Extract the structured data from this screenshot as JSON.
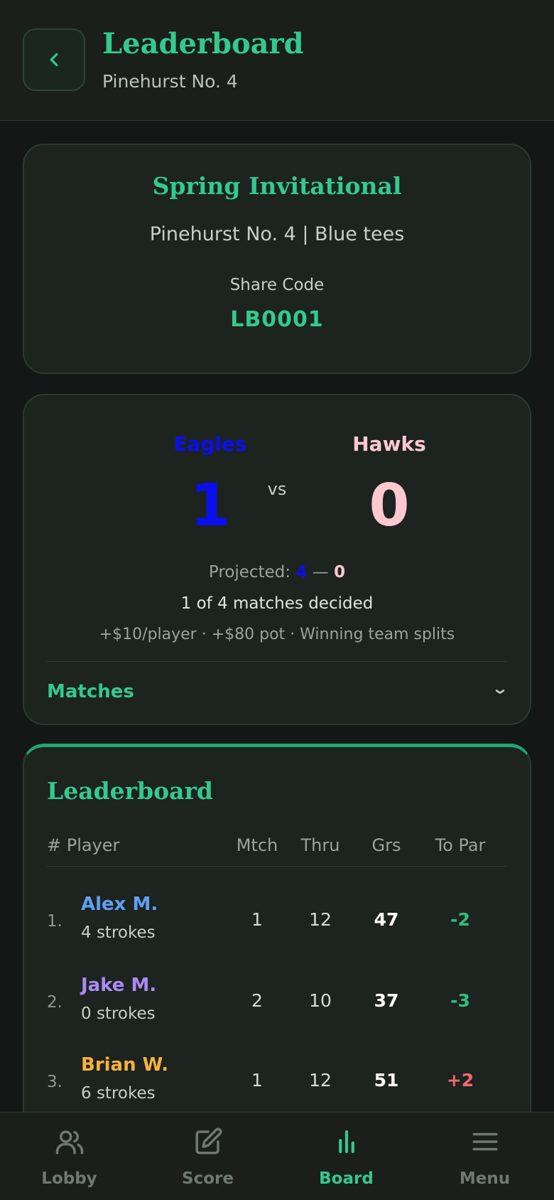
{
  "header": {
    "title": "Leaderboard",
    "subtitle": "Pinehurst No. 4"
  },
  "event": {
    "title": "Spring Invitational",
    "course_line": "Pinehurst No. 4 | Blue tees",
    "share_label": "Share Code",
    "share_code": "LB0001"
  },
  "match": {
    "team_a": {
      "name": "Eagles",
      "score": "1",
      "color": "#0a0ff0"
    },
    "vs": "vs",
    "team_b": {
      "name": "Hawks",
      "score": "0",
      "color": "#ffc8d2"
    },
    "projected_label": "Projected:",
    "projected_a": "4",
    "projected_sep": "—",
    "projected_b": "0",
    "decided": "1 of 4 matches decided",
    "stakes": "+$10/player · +$80 pot · Winning team splits",
    "matches_label": "Matches"
  },
  "leaderboard": {
    "title": "Leaderboard",
    "columns": {
      "player": "# Player",
      "mtch": "Mtch",
      "thru": "Thru",
      "grs": "Grs",
      "par": "To Par"
    },
    "rows": [
      {
        "rank": "1.",
        "name": "Alex M.",
        "strokes": "4 strokes",
        "mtch": "1",
        "thru": "12",
        "grs": "47",
        "par": "-2",
        "name_color": "#5fa0f5",
        "par_color": "#2fbf84"
      },
      {
        "rank": "2.",
        "name": "Jake M.",
        "strokes": "0 strokes",
        "mtch": "2",
        "thru": "10",
        "grs": "37",
        "par": "-3",
        "name_color": "#a98bf5",
        "par_color": "#2fbf84"
      },
      {
        "rank": "3.",
        "name": "Brian W.",
        "strokes": "6 strokes",
        "mtch": "1",
        "thru": "12",
        "grs": "51",
        "par": "+2",
        "name_color": "#f7b23b",
        "par_color": "#f06a6a"
      }
    ]
  },
  "nav": {
    "items": [
      {
        "label": "Lobby",
        "icon": "users-icon"
      },
      {
        "label": "Score",
        "icon": "edit-icon"
      },
      {
        "label": "Board",
        "icon": "bar-chart-icon",
        "active": true
      },
      {
        "label": "Menu",
        "icon": "menu-icon"
      }
    ]
  },
  "colors": {
    "accent": "#34c98e",
    "background": "#131715",
    "card": "#1d231f"
  }
}
